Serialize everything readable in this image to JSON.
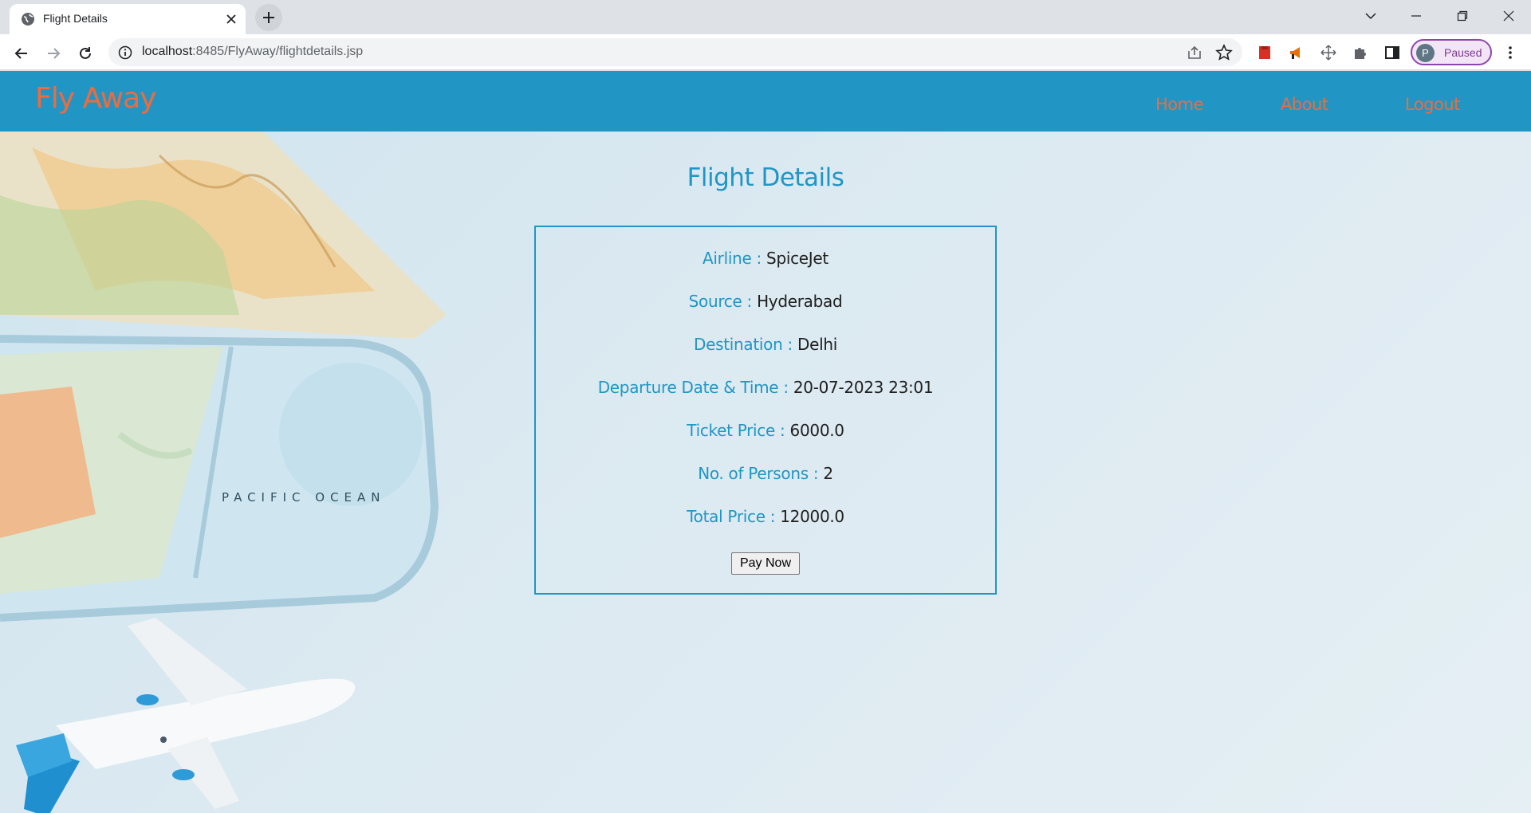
{
  "browser": {
    "tab_title": "Flight Details",
    "url_host": "localhost",
    "url_rest": ":8485/FlyAway/flightdetails.jsp",
    "profile_initial": "P",
    "profile_status": "Paused",
    "icons": [
      "globe-icon",
      "close-icon",
      "plus-icon",
      "chevron-down-icon",
      "minimize-icon",
      "restore-icon",
      "back-arrow-icon",
      "forward-arrow-icon",
      "reload-icon",
      "info-icon",
      "share-icon",
      "star-icon",
      "puzzle-icon",
      "side-panel-icon",
      "kebab-menu-icon"
    ]
  },
  "site": {
    "brand": "Fly Away",
    "nav": {
      "home": "Home",
      "about": "About",
      "logout": "Logout"
    },
    "accent": "#2196c4",
    "brand_color": "#f26a3b"
  },
  "page": {
    "title": "Flight Details",
    "details": [
      {
        "label": "Airline : ",
        "value": "SpiceJet"
      },
      {
        "label": "Source : ",
        "value": "Hyderabad"
      },
      {
        "label": "Destination : ",
        "value": "Delhi"
      },
      {
        "label": "Departure Date & Time : ",
        "value": "20-07-2023 23:01"
      },
      {
        "label": "Ticket Price : ",
        "value": "6000.0"
      },
      {
        "label": "No. of Persons : ",
        "value": "2"
      },
      {
        "label": "Total Price : ",
        "value": "12000.0"
      }
    ],
    "pay_button": "Pay Now",
    "map_text": "PACIFIC OCEAN"
  }
}
